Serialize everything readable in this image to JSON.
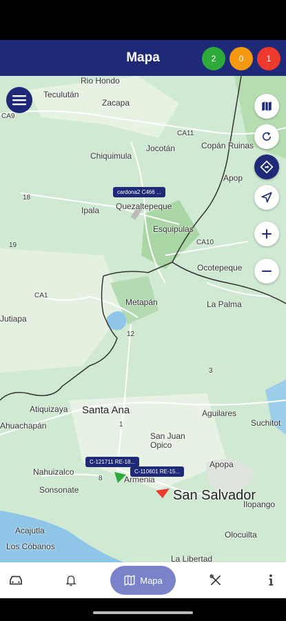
{
  "header": {
    "title": "Mapa"
  },
  "badges": [
    {
      "value": "2",
      "color": "#2eaa3c"
    },
    {
      "value": "0",
      "color": "#f59a10"
    },
    {
      "value": "1",
      "color": "#ee3a2c"
    }
  ],
  "map": {
    "places": {
      "rio_hondo": "Rio Hondo",
      "teculutan": "Teculután",
      "zacapa": "Zacapa",
      "ca9": "CA9",
      "chiquimula": "Chiquimula",
      "jocotan": "Jocotán",
      "ca11": "CA11",
      "copan_ruinas": "Copán Ruinas",
      "apop": "Apop",
      "ipala": "Ipala",
      "quezaltepeque": "Quezaltepeque",
      "r18": "18",
      "esquipulas": "Esquipulas",
      "ca10": "CA10",
      "r19": "19",
      "ocotepeque": "Ocotepeque",
      "ca1": "CA1",
      "jutiapa": "Jutiapa",
      "metapan": "Metapán",
      "la_palma": "La Palma",
      "r12": "12",
      "r3": "3",
      "atiquizaya": "Atiquizaya",
      "santa_ana": "Santa Ana",
      "aguilares": "Aguilares",
      "suchitoto": "Suchitot",
      "ahuachapan": "Ahuachapán",
      "r1": "1",
      "san_juan_opico": "San Juan\nOpico",
      "nahuizalco": "Nahuizalco",
      "apopa": "Apopa",
      "r8": "8",
      "armenia": "Armenia",
      "sonsonate": "Sonsonate",
      "san_salvador": "San Salvador",
      "acajutla": "Acajutla",
      "ilopango": "Ilopango",
      "los_cobanos": "Los Cóbanos",
      "olocuilta": "Olocuilta",
      "la_libertad": "La Libertad"
    },
    "vehicle_tags": {
      "cardona": "cardona2 C466 ...",
      "c121711": "C-121711 RE-18...",
      "c110601": "C-110601 RE-15..."
    }
  },
  "nav": {
    "active_label": "Mapa"
  }
}
